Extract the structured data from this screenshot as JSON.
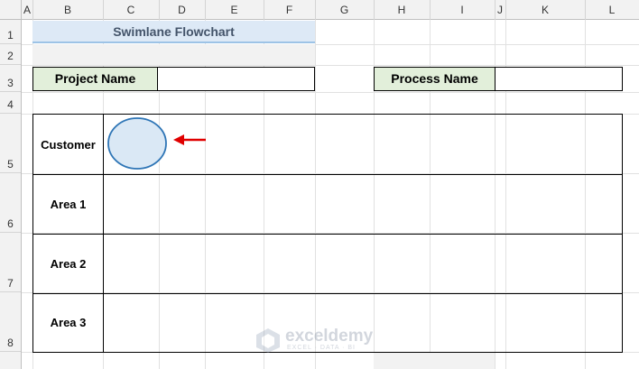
{
  "columns": [
    "A",
    "B",
    "C",
    "D",
    "E",
    "F",
    "G",
    "H",
    "I",
    "J",
    "K",
    "L"
  ],
  "rows": [
    "1",
    "2",
    "3",
    "4",
    "5",
    "6",
    "7",
    "8"
  ],
  "title": "Swimlane Flowchart",
  "project_label": "Project Name",
  "project_value": "",
  "process_label": "Process Name",
  "process_value": "",
  "lanes": [
    "Customer",
    "Area 1",
    "Area 2",
    "Area 3"
  ],
  "watermark": {
    "name": "exceldemy",
    "tagline": "EXCEL · DATA · BI"
  },
  "colors": {
    "title_bg": "#dde9f6",
    "label_bg": "#e2efda",
    "ellipse_fill": "#dae8f5",
    "ellipse_stroke": "#2e75b6",
    "arrow": "#e00000"
  }
}
